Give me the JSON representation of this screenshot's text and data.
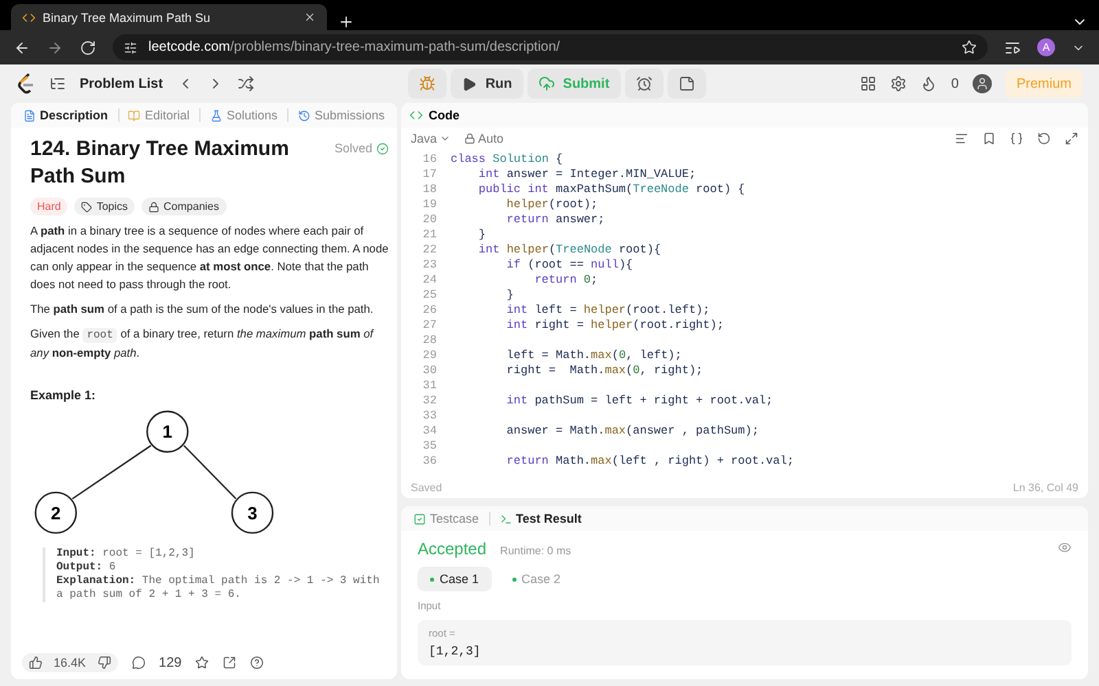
{
  "browser": {
    "tab_title": "Binary Tree Maximum Path Su",
    "url_host": "leetcode.com",
    "url_path": "/problems/binary-tree-maximum-path-sum/description/",
    "profile": "A"
  },
  "toolbar": {
    "problem_list": "Problem List",
    "run": "Run",
    "submit": "Submit",
    "streak": "0",
    "premium": "Premium"
  },
  "left_tabs": [
    {
      "label": "Description",
      "selected": true,
      "kind": "description"
    },
    {
      "label": "Editorial",
      "selected": false,
      "kind": "editorial"
    },
    {
      "label": "Solutions",
      "selected": false,
      "kind": "solutions"
    },
    {
      "label": "Submissions",
      "selected": false,
      "kind": "submissions"
    }
  ],
  "problem": {
    "title": "124. Binary Tree Maximum Path Sum",
    "status": "Solved",
    "difficulty": "Hard",
    "tags": [
      {
        "label": "Topics",
        "kind": "tag"
      },
      {
        "label": "Companies",
        "kind": "lock"
      }
    ],
    "paragraphs": [
      [
        {
          "kind": "text",
          "text": "A **path** in a binary tree is a sequence of nodes where each pair of adjacent nodes in the sequence has an edge connecting them. A node can only appear in the sequence **at most once**. Note that the path does not need to pass through the root."
        }
      ],
      [
        {
          "kind": "text",
          "text": "The **path sum** of a path is the sum of the node's values in the path."
        }
      ],
      [
        {
          "kind": "text",
          "text": "Given the "
        },
        {
          "kind": "code",
          "text": "root"
        },
        {
          "kind": "text",
          "text": " of a binary tree, return *the maximum* **path sum** *of any* **non-empty** *path*."
        }
      ]
    ],
    "example_title": "Example 1:",
    "tree": {
      "nodes": [
        "1",
        "2",
        "3"
      ]
    },
    "example_lines": [
      "**Input:** root = [1,2,3]",
      "**Output:** 6",
      "**Explanation:** The optimal path is 2 -> 1 -> 3 with a path sum of 2 + 1 + 3 = 6."
    ],
    "likes": "16.4K",
    "comments": "129"
  },
  "code_panel": {
    "title": "Code",
    "language": "Java",
    "mode": "Auto",
    "status": "Saved",
    "cursor": "Ln 36, Col 49",
    "lines": [
      {
        "n": "16",
        "code": [
          {
            "kind": "kw",
            "text": "class"
          },
          {
            "kind": "type",
            "text": " Solution"
          },
          {
            "kind": "plain",
            "text": " {"
          }
        ]
      },
      {
        "n": "17",
        "code": [
          {
            "kind": "kw",
            "text": "    int"
          },
          {
            "kind": "plain",
            "text": " answer = Integer.MIN_VALUE;"
          }
        ]
      },
      {
        "n": "18",
        "code": [
          {
            "kind": "kw",
            "text": "    public int"
          },
          {
            "kind": "plain",
            "text": " maxPathSum("
          },
          {
            "kind": "type",
            "text": "TreeNode"
          },
          {
            "kind": "plain",
            "text": " root) {"
          }
        ]
      },
      {
        "n": "19",
        "code": [
          {
            "kind": "fn",
            "text": "        helper"
          },
          {
            "kind": "plain",
            "text": "(root);"
          }
        ]
      },
      {
        "n": "20",
        "code": [
          {
            "kind": "kw",
            "text": "        return"
          },
          {
            "kind": "plain",
            "text": " answer;"
          }
        ]
      },
      {
        "n": "21",
        "code": [
          {
            "kind": "plain",
            "text": "    }"
          }
        ]
      },
      {
        "n": "22",
        "code": [
          {
            "kind": "kw",
            "text": "    int"
          },
          {
            "kind": "fn",
            "text": " helper"
          },
          {
            "kind": "plain",
            "text": "("
          },
          {
            "kind": "type",
            "text": "TreeNode"
          },
          {
            "kind": "plain",
            "text": " root){"
          }
        ]
      },
      {
        "n": "23",
        "code": [
          {
            "kind": "kw",
            "text": "        if"
          },
          {
            "kind": "plain",
            "text": " (root == "
          },
          {
            "kind": "kw",
            "text": "null"
          },
          {
            "kind": "plain",
            "text": "){"
          }
        ]
      },
      {
        "n": "24",
        "code": [
          {
            "kind": "kw",
            "text": "            return"
          },
          {
            "kind": "num",
            "text": " 0"
          },
          {
            "kind": "plain",
            "text": ";"
          }
        ]
      },
      {
        "n": "25",
        "code": [
          {
            "kind": "plain",
            "text": "        }"
          }
        ]
      },
      {
        "n": "26",
        "code": [
          {
            "kind": "kw",
            "text": "        int"
          },
          {
            "kind": "plain",
            "text": " left = "
          },
          {
            "kind": "fn",
            "text": "helper"
          },
          {
            "kind": "plain",
            "text": "(root.left);"
          }
        ]
      },
      {
        "n": "27",
        "code": [
          {
            "kind": "kw",
            "text": "        int"
          },
          {
            "kind": "plain",
            "text": " right = "
          },
          {
            "kind": "fn",
            "text": "helper"
          },
          {
            "kind": "plain",
            "text": "(root.right);"
          }
        ]
      },
      {
        "n": "28"
      },
      {
        "n": "29",
        "code": [
          {
            "kind": "plain",
            "text": "        left = Math."
          },
          {
            "kind": "fn",
            "text": "max"
          },
          {
            "kind": "plain",
            "text": "("
          },
          {
            "kind": "num",
            "text": "0"
          },
          {
            "kind": "plain",
            "text": ", left);"
          }
        ]
      },
      {
        "n": "30",
        "code": [
          {
            "kind": "plain",
            "text": "        right =  Math."
          },
          {
            "kind": "fn",
            "text": "max"
          },
          {
            "kind": "plain",
            "text": "("
          },
          {
            "kind": "num",
            "text": "0"
          },
          {
            "kind": "plain",
            "text": ", right);"
          }
        ]
      },
      {
        "n": "31"
      },
      {
        "n": "32",
        "code": [
          {
            "kind": "kw",
            "text": "        int"
          },
          {
            "kind": "plain",
            "text": " pathSum = left + right + root.val;"
          }
        ]
      },
      {
        "n": "33"
      },
      {
        "n": "34",
        "code": [
          {
            "kind": "plain",
            "text": "        answer = Math."
          },
          {
            "kind": "fn",
            "text": "max"
          },
          {
            "kind": "plain",
            "text": "(answer , pathSum);"
          }
        ]
      },
      {
        "n": "35"
      },
      {
        "n": "36",
        "code": [
          {
            "kind": "kw",
            "text": "        return"
          },
          {
            "kind": "plain",
            "text": " Math."
          },
          {
            "kind": "fn",
            "text": "max"
          },
          {
            "kind": "plain",
            "text": "(left , right) + root.val;"
          }
        ]
      }
    ]
  },
  "test_panel": {
    "tabs": [
      {
        "label": "Testcase",
        "selected": false,
        "kind": "testcase"
      },
      {
        "label": "Test Result",
        "selected": true,
        "kind": "result"
      }
    ],
    "verdict": "Accepted",
    "runtime": "Runtime: 0 ms",
    "cases": [
      {
        "label": "Case 1",
        "selected": true
      },
      {
        "label": "Case 2",
        "selected": false
      }
    ],
    "input_label": "Input",
    "input_name": "root =",
    "input_value": "[1,2,3]"
  }
}
